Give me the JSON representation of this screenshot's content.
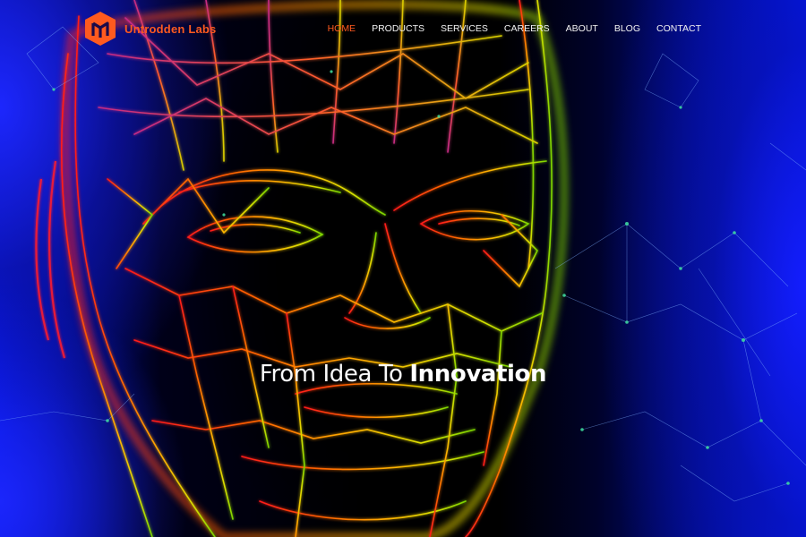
{
  "brand": {
    "name": "Untrodden Labs",
    "color": "#ff5a1f"
  },
  "nav": {
    "items": [
      {
        "label": "HOME",
        "active": true
      },
      {
        "label": "PRODUCTS",
        "active": false
      },
      {
        "label": "SERVICES",
        "active": false
      },
      {
        "label": "CAREERS",
        "active": false
      },
      {
        "label": "ABOUT",
        "active": false
      },
      {
        "label": "BLOG",
        "active": false
      },
      {
        "label": "CONTACT",
        "active": false
      }
    ]
  },
  "hero": {
    "heading_part1": "From Idea To",
    "heading_part2": "Innovation",
    "background_image": "wireframe-face-network-art",
    "colors": {
      "accent": "#ff5a1f",
      "background_blue": "#0014ee",
      "background_dark": "#000000"
    }
  }
}
